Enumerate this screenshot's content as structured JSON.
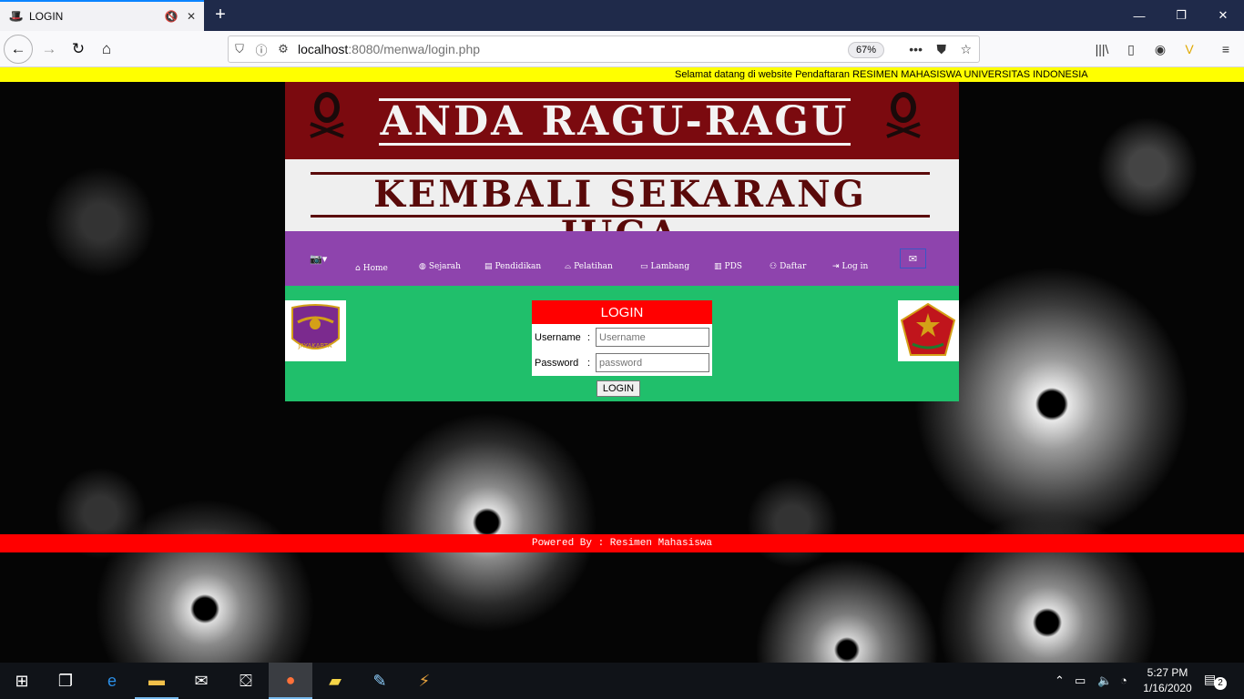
{
  "browser": {
    "tab_title": "LOGIN",
    "url_host": "localhost",
    "url_path": ":8080/menwa/login.php",
    "zoom": "67%"
  },
  "page": {
    "marquee": "Selamat datang di website Pendaftaran RESIMEN MAHASISWA UNIVERSITAS INDONESIA",
    "banner_line1": "ANDA RAGU-RAGU",
    "banner_line2": "KEMBALI SEKARANG JUGA",
    "menu": [
      {
        "label": "Home",
        "icon": "home-icon"
      },
      {
        "label": "Sejarah",
        "icon": "globe-icon"
      },
      {
        "label": "Pendidikan",
        "icon": "book-icon"
      },
      {
        "label": "Pelatihan",
        "icon": "graduation-cap-icon"
      },
      {
        "label": "Lambang",
        "icon": "laptop-icon"
      },
      {
        "label": "PDS",
        "icon": "map-icon"
      },
      {
        "label": "Daftar",
        "icon": "users-icon"
      },
      {
        "label": "Log in",
        "icon": "sign-in-icon"
      }
    ],
    "logo_left_text": "JAYAKARTA",
    "login": {
      "title": "LOGIN",
      "username_label": "Username",
      "password_label": "Password",
      "colon": ":",
      "username_placeholder": "Username",
      "password_placeholder": "password",
      "button_label": "LOGIN"
    },
    "footer": "Powered By : Resimen Mahasiswa"
  },
  "taskbar": {
    "time": "5:27 PM",
    "date": "1/16/2020",
    "notification_count": "2"
  },
  "colors": {
    "marquee_bg": "#ffff00",
    "banner_top": "#7b0a0f",
    "menubar": "#8e44ad",
    "content": "#20bf6b",
    "login_header": "#ff0000",
    "footer": "#ff0000"
  }
}
